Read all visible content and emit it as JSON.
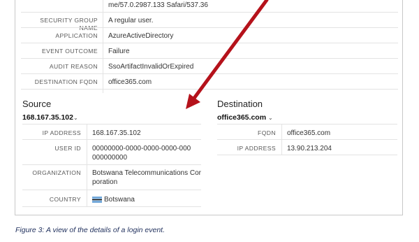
{
  "top_details": {
    "user_agent_fragment": "me/57.0.2987.133 Safari/537.36",
    "rows": [
      {
        "label": "SECURITY GROUP NAME",
        "value": "A regular user."
      },
      {
        "label": "APPLICATION",
        "value": "AzureActiveDirectory"
      },
      {
        "label": "EVENT OUTCOME",
        "value": "Failure"
      },
      {
        "label": "AUDIT REASON",
        "value": "SsoArtifactInvalidOrExpired"
      },
      {
        "label": "DESTINATION FQDN",
        "value": "office365.com"
      }
    ]
  },
  "source": {
    "title": "Source",
    "selected_ip": "168.167.35.102",
    "rows": [
      {
        "label": "IP ADDRESS",
        "value": "168.167.35.102"
      },
      {
        "label": "USER ID",
        "value_line1": "00000000-0000-0000-0000-000",
        "value_line2": "000000000"
      },
      {
        "label": "ORGANIZATION",
        "value_line1": "Botswana Telecommunications Cor",
        "value_line2": "poration"
      },
      {
        "label": "COUNTRY",
        "value": "Botswana",
        "flag_icon": "botswana-flag-icon"
      }
    ]
  },
  "destination": {
    "title": "Destination",
    "selected_host": "office365.com",
    "rows": [
      {
        "label": "FQDN",
        "value": "office365.com"
      },
      {
        "label": "IP ADDRESS",
        "value": "13.90.213.204"
      }
    ]
  },
  "annotation": {
    "arrow_color": "#b5121b"
  },
  "caption": "Figure 3: A view of the details of a login event."
}
